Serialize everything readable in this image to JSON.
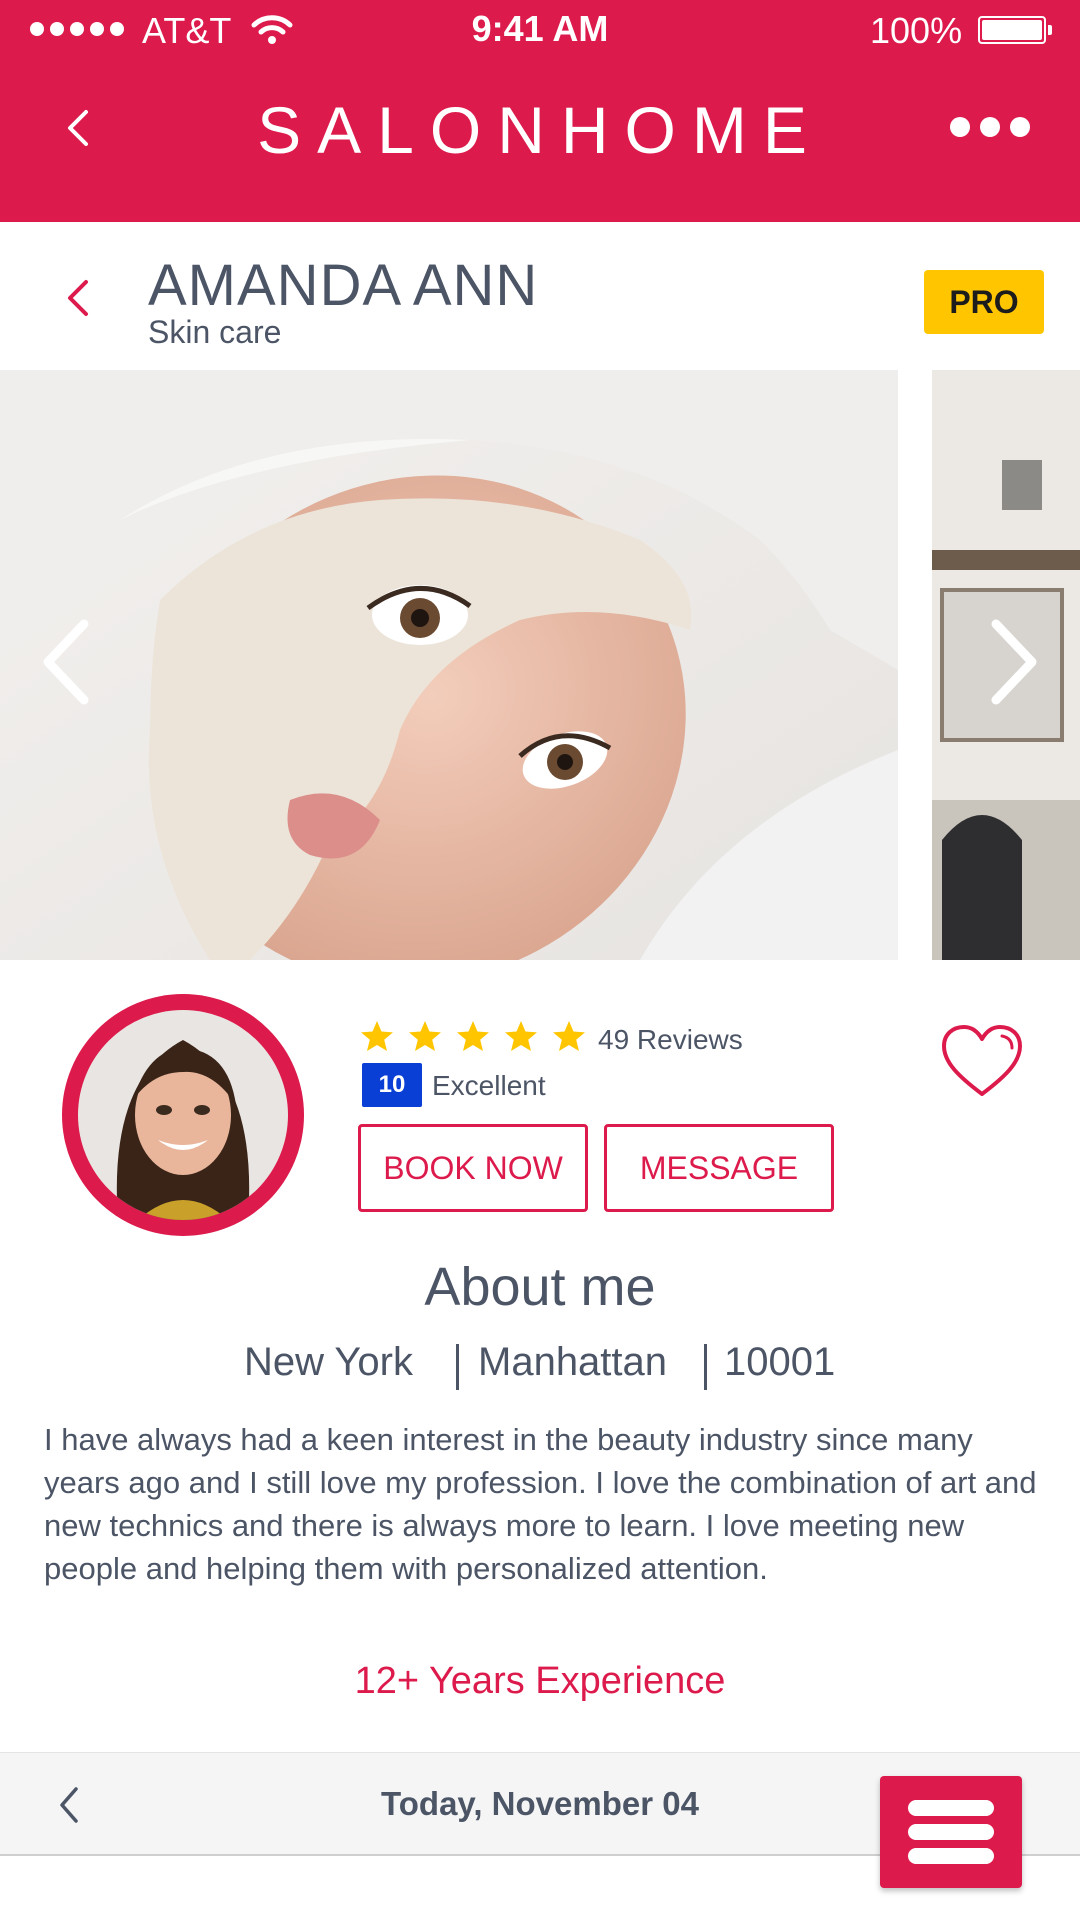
{
  "status_bar": {
    "carrier": "AT&T",
    "time": "9:41 AM",
    "battery": "100%"
  },
  "header": {
    "app_title": "SALONHOME",
    "icons": {
      "back": "chevron-left-icon",
      "more": "more-dots-icon"
    }
  },
  "profile": {
    "name": "AMANDA ANN",
    "specialty": "Skin care",
    "badge": "PRO",
    "reviews_label": "49 Reviews",
    "star_rating": 5,
    "score": "10",
    "score_label": "Excellent"
  },
  "gallery": {
    "icons": {
      "prev": "chevron-left-icon",
      "next": "chevron-right-icon"
    }
  },
  "actions": {
    "book_label": "BOOK NOW",
    "message_label": "MESSAGE",
    "favorite_icon": "heart-icon"
  },
  "about": {
    "title": "About me",
    "city": "New York",
    "area": "Manhattan",
    "zip": "10001",
    "bio": "I have always had a keen interest in the beauty industry since many years ago and I still love my profession. I love the combination of art and new technics and there is always more to learn. I love meeting new people and helping them with personalized attention.",
    "experience": "12+ Years Experience"
  },
  "bottom_bar": {
    "date": "Today, November 04",
    "icons": {
      "back": "chevron-left-icon",
      "menu": "hamburger-menu-icon"
    }
  },
  "colors": {
    "brand": "#dd1a4c",
    "text": "#4c5566",
    "pro_badge": "#ffc600",
    "score_badge": "#0a3fd6",
    "star": "#ffc600"
  }
}
